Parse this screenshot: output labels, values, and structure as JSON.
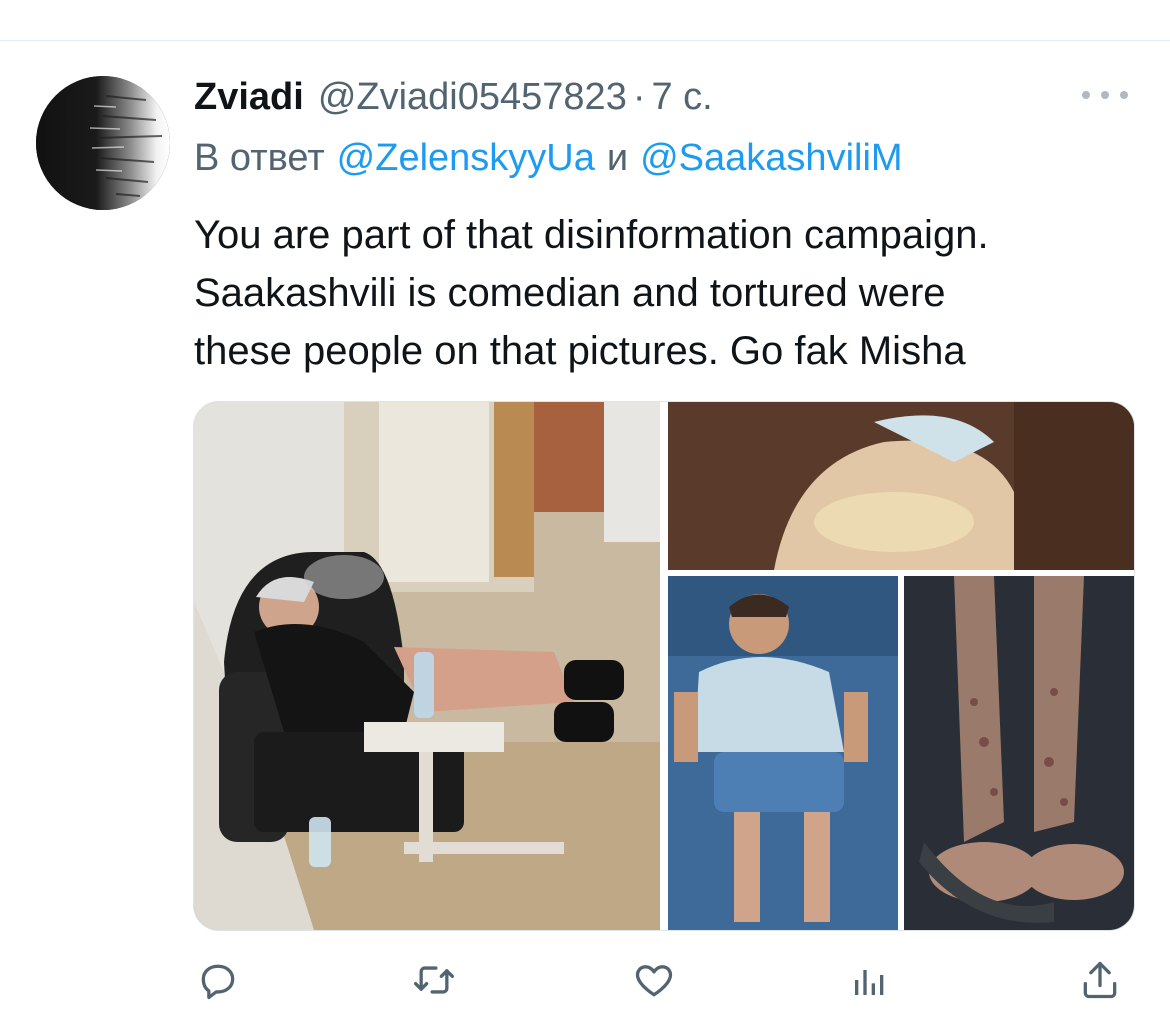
{
  "tweet": {
    "name": "Zviadi",
    "handle": "@Zviadi05457823",
    "separator": "·",
    "time": "7 с.",
    "reply_prefix": "В ответ",
    "mention_1": "@ZelenskyyUa",
    "reply_and": "и",
    "mention_2": "@SaakashviliM",
    "text_lines": [
      "You are part of that disinformation campaign.",
      "Saakashvili is comedian and tortured were",
      "these people on that pictures. Go fak Misha"
    ]
  },
  "actions": [
    {
      "icon": "reply-icon"
    },
    {
      "icon": "retweet-icon"
    },
    {
      "icon": "like-icon"
    },
    {
      "icon": "analytics-icon"
    },
    {
      "icon": "share-icon"
    }
  ],
  "colors": {
    "text": "#0f1419",
    "secondary": "#536471",
    "link": "#1d9bf0",
    "icon": "#536471"
  }
}
